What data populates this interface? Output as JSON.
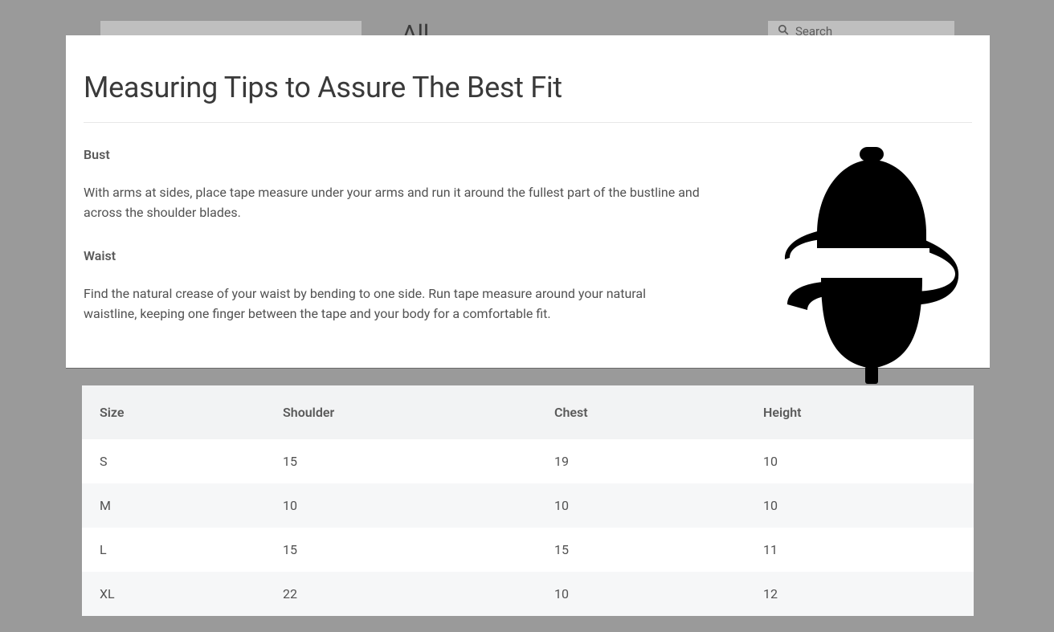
{
  "background": {
    "title_fragment": "All",
    "search_placeholder": "Search"
  },
  "modal": {
    "title": "Measuring Tips to Assure The Best Fit",
    "sections": [
      {
        "title": "Bust",
        "body": "With arms at sides, place tape measure under your arms and run it around the fullest part of the bustline and across the shoulder blades."
      },
      {
        "title": "Waist",
        "body": "Find the natural crease of your waist by bending to one side. Run tape measure around your natural waistline, keeping one finger between the tape and your body for a comfortable fit."
      }
    ],
    "illustration": "dress-form-icon"
  },
  "size_table": {
    "headers": [
      "Size",
      "Shoulder",
      "Chest",
      "Height"
    ],
    "rows": [
      {
        "size": "S",
        "shoulder": "15",
        "chest": "19",
        "height": "10"
      },
      {
        "size": "M",
        "shoulder": "10",
        "chest": "10",
        "height": "10"
      },
      {
        "size": "L",
        "shoulder": "15",
        "chest": "15",
        "height": "11"
      },
      {
        "size": "XL",
        "shoulder": "22",
        "chest": "10",
        "height": "12"
      }
    ]
  }
}
